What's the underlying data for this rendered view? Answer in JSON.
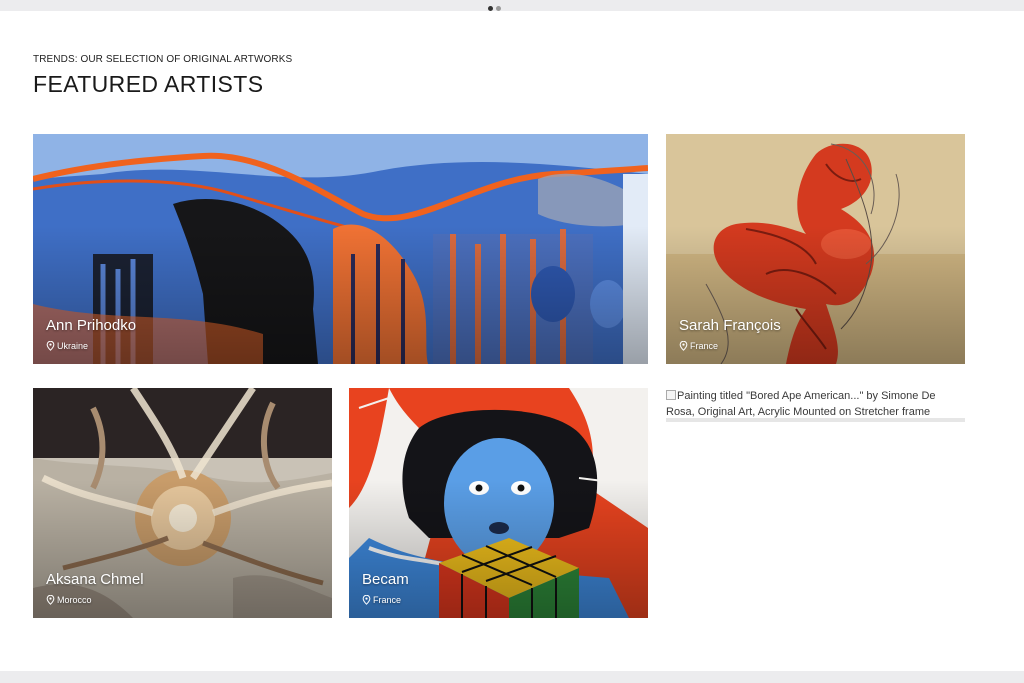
{
  "header": {
    "eyebrow": "TRENDS: OUR SELECTION OF ORIGINAL ARTWORKS",
    "title": "FEATURED ARTISTS"
  },
  "carousel": {
    "dots": 2,
    "active_index": 0
  },
  "artists": [
    {
      "name": "Ann Prihodko",
      "location": "Ukraine"
    },
    {
      "name": "Sarah François",
      "location": "France"
    },
    {
      "name": "Aksana Chmel",
      "location": "Morocco"
    },
    {
      "name": "Becam",
      "location": "France"
    }
  ],
  "broken_image": {
    "alt": "Painting titled \"Bored Ape American...\" by Simone De Rosa, Original Art, Acrylic Mounted on Stretcher frame"
  },
  "icons": {
    "location": "map-pin-icon"
  },
  "colors": {
    "background": "#ffffff",
    "page_strip": "#ececee",
    "overlay_text": "#ffffff"
  }
}
